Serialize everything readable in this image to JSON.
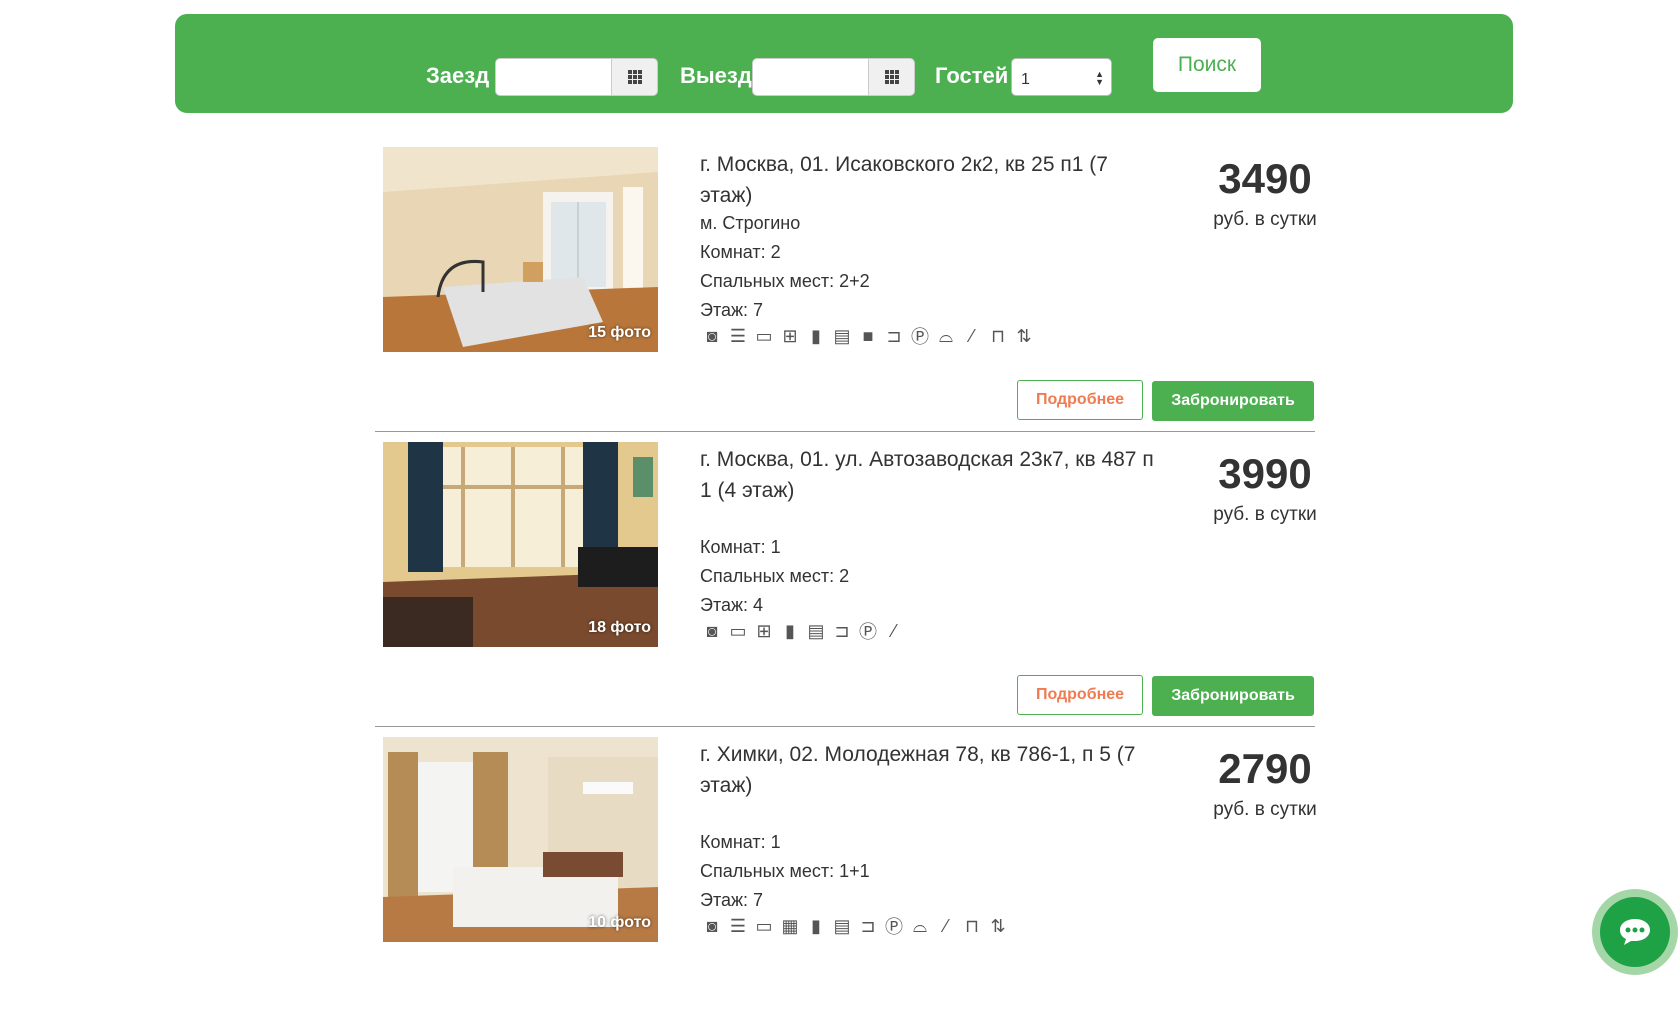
{
  "search": {
    "checkin_label": "Заезд",
    "checkout_label": "Выезд",
    "guests_label": "Гостей",
    "guests_value": "1",
    "search_button": "Поиск"
  },
  "listings": [
    {
      "address": "г. Москва, 01. Исаковского 2к2, кв 25 п1 (7 этаж)",
      "metro": "м. Строгино",
      "rooms": "Комнат: 2",
      "beds": "Спальных мест: 2+2",
      "floor": "Этаж: 7",
      "photos": "15 фото",
      "price": "3490",
      "price_unit": "руб. в сутки",
      "more": "Подробнее",
      "book": "Забронировать",
      "amenities": [
        "washer-icon",
        "wifi-icon",
        "tv-icon",
        "crib-icon",
        "fridge-icon",
        "microwave-icon",
        "oven-icon",
        "hairdryer-icon",
        "parking-icon",
        "iron-icon",
        "shower-icon",
        "dining-icon",
        "elevator-icon"
      ]
    },
    {
      "address": "г. Москва, 01. ул. Автозаводская 23к7, кв 487 п 1 (4 этаж)",
      "metro": "",
      "rooms": "Комнат: 1",
      "beds": "Спальных мест: 2",
      "floor": "Этаж: 4",
      "photos": "18 фото",
      "price": "3990",
      "price_unit": "руб. в сутки",
      "more": "Подробнее",
      "book": "Забронировать",
      "amenities": [
        "washer-icon",
        "tv-icon",
        "crib-icon",
        "fridge-icon",
        "microwave-icon",
        "hairdryer-icon",
        "parking-icon",
        "shower-icon"
      ]
    },
    {
      "address": "г. Химки, 02. Молодежная 78, кв 786-1, п 5 (7 этаж)",
      "metro": "",
      "rooms": "Комнат: 1",
      "beds": "Спальных мест: 1+1",
      "floor": "Этаж: 7",
      "photos": "10 фото",
      "price": "2790",
      "price_unit": "руб. в сутки",
      "more": "Подробнее",
      "book": "Забронировать",
      "amenities": [
        "washer-icon",
        "wifi-icon",
        "tv-icon",
        "air-conditioner-icon",
        "fridge-icon",
        "microwave-icon",
        "hairdryer-icon",
        "parking-icon",
        "iron-icon",
        "shower-icon",
        "dining-icon",
        "elevator-icon"
      ]
    }
  ],
  "colors": {
    "brand_green": "#4caf50",
    "more_text": "#f07b52"
  }
}
